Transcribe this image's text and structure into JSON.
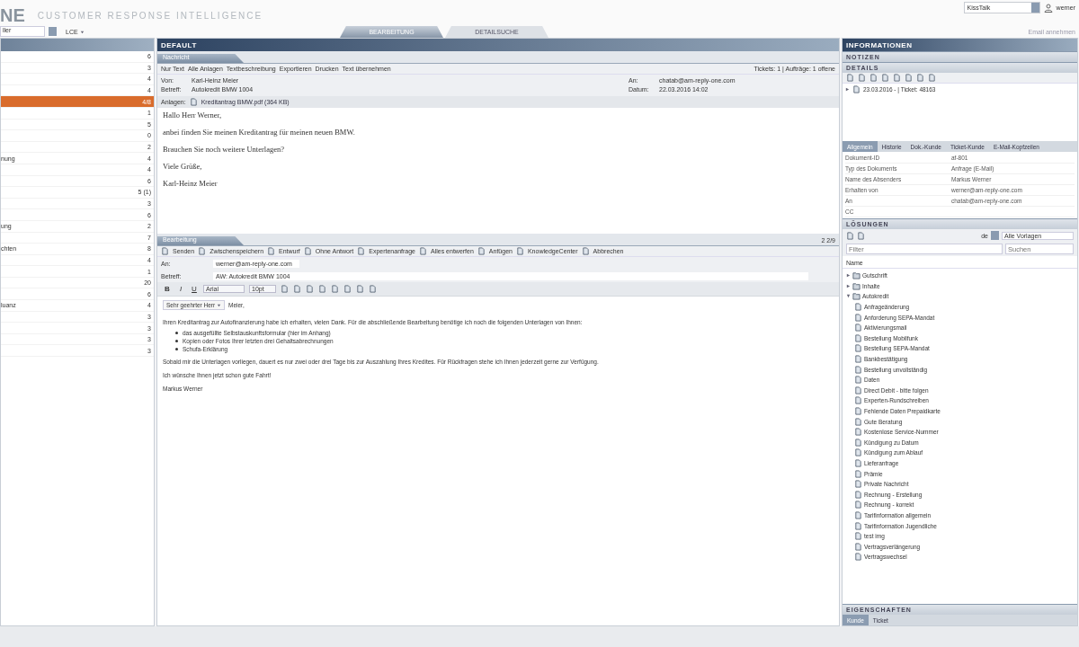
{
  "header": {
    "logo": "NE",
    "product": "CUSTOMER RESPONSE INTELLIGENCE",
    "search": "KissTalk",
    "user": "werner"
  },
  "toolbar": {
    "filter": "ller",
    "view": "LCE",
    "tabs": [
      {
        "label": "BEARBEITUNG",
        "selected": true
      },
      {
        "label": "DETAILSUCHE",
        "selected": false
      }
    ],
    "action": "Email annehmen"
  },
  "queues": {
    "items": [
      {
        "count": "6",
        "selected": false
      },
      {
        "count": "3",
        "selected": false
      },
      {
        "count": "4",
        "selected": false
      },
      {
        "count": "4",
        "selected": false
      },
      {
        "count": "4/8",
        "selected": true
      },
      {
        "count": "1",
        "selected": false
      },
      {
        "count": "5",
        "selected": false
      },
      {
        "count": "0",
        "selected": false
      },
      {
        "count": "2",
        "selected": false
      },
      {
        "label": "nung",
        "count": "4",
        "selected": false
      },
      {
        "count": "4",
        "selected": false
      },
      {
        "count": "6",
        "selected": false
      },
      {
        "count": "5 (1)",
        "selected": false
      },
      {
        "count": "3",
        "selected": false
      },
      {
        "count": "6",
        "selected": false
      },
      {
        "label": "ung",
        "count": "2",
        "selected": false
      },
      {
        "count": "7",
        "selected": false
      },
      {
        "label": "chten",
        "count": "8",
        "selected": false
      },
      {
        "count": "4",
        "selected": false
      },
      {
        "count": "1",
        "selected": false
      },
      {
        "count": "20",
        "selected": false
      },
      {
        "count": "6",
        "selected": false
      },
      {
        "label": "luanz",
        "count": "4",
        "selected": false
      },
      {
        "count": "3",
        "selected": false
      },
      {
        "count": "3",
        "selected": false
      },
      {
        "count": "3",
        "selected": false
      },
      {
        "count": "3",
        "selected": false
      }
    ]
  },
  "center": {
    "title": "DEFAULT",
    "message": {
      "tab": "Nachricht",
      "actions": [
        "Nur Text",
        "Alle Anlagen",
        "Textbeschreibung",
        "Exportieren",
        "Drucken",
        "Text übernehmen"
      ],
      "summary": "Tickets: 1 | Aufträge: 1 offene",
      "meta_left": [
        {
          "label": "Von:",
          "value": "Karl-Heinz Meier"
        },
        {
          "label": "Betreff:",
          "value": "Autokredit BMW 1004"
        }
      ],
      "meta_right": [
        {
          "label": "An:",
          "value": "chatab@am-reply-one.com"
        },
        {
          "label": "Datum:",
          "value": "22.03.2016 14:02"
        }
      ],
      "attachments_label": "Anlagen:",
      "attachment": "Kreditantrag BMW.pdf (364 KB)",
      "body": [
        "Hallo Herr Werner,",
        "anbei finden Sie meinen Kreditantrag für meinen neuen BMW.",
        "Brauchen Sie noch weitere Unterlagen?",
        "Viele Grüße,",
        "Karl-Heinz Meier"
      ]
    },
    "reply": {
      "tab": "Bearbeitung",
      "actions": [
        "Senden",
        "Zwischenspeichern",
        "Entwurf",
        "Ohne Antwort",
        "Expertenanfrage",
        "Alles entwerfen",
        "Anfügen",
        "KnowledgeCenter",
        "Abbrechen"
      ],
      "counter": "2 2/9",
      "to_label": "An:",
      "to": "werner@am-reply-one.com",
      "subject_label": "Betreff:",
      "subject": "AW: Autokredit BMW 1004",
      "format_buttons": [
        "B",
        "I",
        "U"
      ],
      "font": "Arial",
      "size": "10pt",
      "salutation": "Sehr geehrter Herr",
      "salutation_name": "Meier,",
      "intro": "Ihren Kreditantrag zur Autofinanzierung habe ich erhalten, vielen Dank. Für die abschließende Bearbeitung benötige ich noch die folgenden Unterlagen von Ihnen:",
      "bullets": [
        "das ausgefüllte Selbstauskunftsformular (hier im Anhang)",
        "Kopien oder Fotos Ihrer letzten drei Gehaltsabrechnungen",
        "Schufa-Erklärung"
      ],
      "paragraphs": [
        "Sobald mir die Unterlagen vorliegen, dauert es nur zwei oder drei Tage bis zur Auszahlung Ihres Kredites. Für Rückfragen stehe ich Ihnen jederzeit gerne zur Verfügung.",
        "Ich wünsche Ihnen jetzt schon gute Fahrt!",
        "Markus Werner"
      ]
    }
  },
  "info": {
    "title": "INFORMATIONEN",
    "notes": "NOTIZEN",
    "details": "DETAILS",
    "detail_item": "23.03.2016 - | Ticket: 48163",
    "tabs": [
      {
        "label": "Allgemein",
        "selected": true
      },
      {
        "label": "Historie",
        "selected": false
      },
      {
        "label": "Dok.-Kunde",
        "selected": false
      },
      {
        "label": "Ticket-Kunde",
        "selected": false
      },
      {
        "label": "E-Mail-Kopfzeilen",
        "selected": false
      }
    ],
    "properties": [
      {
        "name": "Dokument-ID",
        "value": "af-801"
      },
      {
        "name": "Typ des Dokuments",
        "value": "Anfrage (E-Mail)"
      },
      {
        "name": "Name des Absenders",
        "value": "Markus Werner"
      },
      {
        "name": "Erhalten von",
        "value": "werner@am-reply-one.com"
      },
      {
        "name": "An",
        "value": "chatab@am-reply-one.com"
      },
      {
        "name": "CC"
      }
    ],
    "solutions": {
      "title": "LÖSUNGEN",
      "language": "de",
      "template": "Alle Vorlagen",
      "filter_placeholder": "Filter",
      "search_placeholder": "Suchen",
      "column": "Name",
      "tree": [
        {
          "label": "Gutschrift",
          "expanded": false
        },
        {
          "label": "Inhalte",
          "expanded": false
        },
        {
          "label": "Autokredit",
          "expanded": true,
          "children": [
            "Anfrageänderung",
            "Anforderung SEPA-Mandat",
            "Aktivierungsmail",
            "Bestellung Mobilfunk",
            "Bestellung SEPA-Mandat",
            "Bankbestätigung",
            "Bestellung unvollständig",
            "Daten",
            "Direct Debit - bitte folgen",
            "Experten-Rundschreiben",
            "Fehlende Daten Prepaidkarte",
            "Gute Beratung",
            "Kostenlose Service-Nummer",
            "Kündigung zu Datum",
            "Kündigung zum Ablauf",
            "Lieferanfrage",
            "Prämie",
            "Private Nachricht",
            "Rechnung - Erstellung",
            "Rechnung - korrekt",
            "Tarifinformation allgemein",
            "Tarifinformation Jugendliche",
            "test img",
            "Vertragsverlängerung",
            "Vertragswechsel"
          ]
        }
      ]
    },
    "properties_title": "EIGENSCHAFTEN",
    "bottom_tabs": [
      {
        "label": "Kunde",
        "selected": true
      },
      {
        "label": "Ticket",
        "selected": false
      }
    ]
  }
}
